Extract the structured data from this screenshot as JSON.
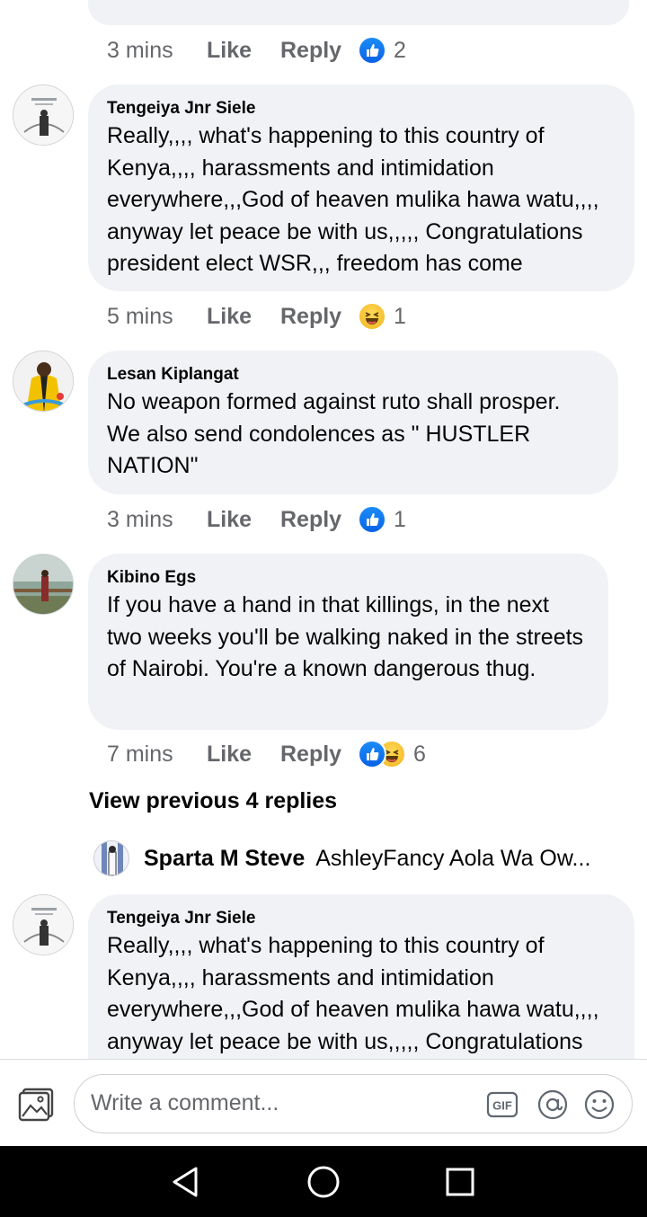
{
  "thread": {
    "top_meta": {
      "time": "3 mins",
      "like": "Like",
      "reply": "Reply",
      "reaction_count": "2",
      "reactions": [
        "like-icon"
      ]
    },
    "comments": [
      {
        "author": "Tengeiya Jnr Siele",
        "text": "Really,,,, what's happening to this country of Kenya,,,, harassments and intimidation everywhere,,,God of heaven mulika hawa watu,,,, anyway let peace be with us,,,,, Congratulations president elect WSR,,, freedom has come",
        "time": "5 mins",
        "like": "Like",
        "reply": "Reply",
        "reaction_count": "1",
        "reactions": [
          "haha-icon"
        ]
      },
      {
        "author": "Lesan Kiplangat",
        "text": "No weapon formed against ruto shall prosper. We also send condolences as \" HUSTLER NATION\"",
        "time": "3 mins",
        "like": "Like",
        "reply": "Reply",
        "reaction_count": "1",
        "reactions": [
          "like-icon"
        ]
      },
      {
        "author": "Kibino Egs",
        "text": "If you have a hand in that killings, in the next two weeks you'll be walking naked in the streets of Nairobi. You're a known dangerous thug.",
        "time": "7 mins",
        "like": "Like",
        "reply": "Reply",
        "reaction_count": "6",
        "reactions": [
          "like-icon",
          "haha-icon"
        ]
      },
      {
        "author": "Tengeiya Jnr Siele",
        "text": "Really,,,, what's happening to this country of Kenya,,,, harassments and intimidation everywhere,,,God of heaven mulika hawa watu,,,, anyway let peace be with us,,,,, Congratulations"
      }
    ],
    "view_previous": "View previous 4 replies",
    "reply_preview": {
      "name": "Sparta M Steve",
      "snippet": "AshleyFancy Aola Wa Ow..."
    }
  },
  "composer": {
    "placeholder": "Write a comment...",
    "icons": [
      "photo-icon",
      "gif-icon",
      "mention-icon",
      "emoji-icon"
    ]
  },
  "system_nav": {
    "icons": [
      "back-triangle-icon",
      "home-circle-icon",
      "recents-square-icon"
    ]
  },
  "colors": {
    "bubble": "#f0f2f5",
    "meta_text": "#65676b",
    "like_blue": "#1877f2",
    "haha_yellow": "#f7c23c"
  }
}
